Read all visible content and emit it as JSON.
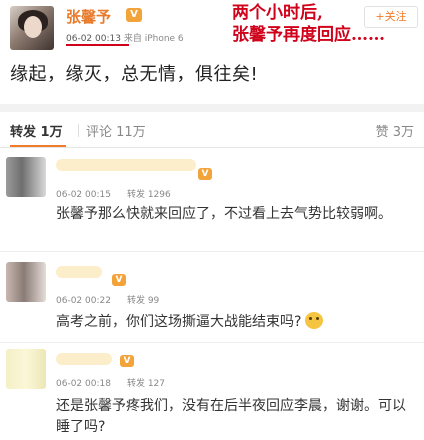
{
  "post": {
    "author": "张馨予",
    "vip_badge": "V",
    "time": "06-02 00:13",
    "source": "来自 iPhone 6",
    "annotation_line1": "两个小时后,",
    "annotation_line2": "张馨予再度回应……",
    "follow_label": "+关注",
    "text": "缘起，缘灭，总无情，俱往矣!"
  },
  "tabs": {
    "repost": "转发 1万",
    "comment": "评论 11万",
    "like": "赞 3万"
  },
  "comments": [
    {
      "time": "06-02 00:15",
      "repost_count": "转发 1296",
      "text": "张馨予那么快就来回应了，不过看上去气势比较弱啊。"
    },
    {
      "time": "06-02 00:22",
      "repost_count": "转发 99",
      "text": "高考之前，你们这场撕逼大战能结束吗?"
    },
    {
      "time": "06-02 00:18",
      "repost_count": "转发 127",
      "text": "还是张馨予疼我们，没有在后半夜回应李晨，谢谢。可以睡了吗?"
    }
  ],
  "colors": {
    "accent": "#f07c29",
    "annotation": "#d0021b"
  }
}
